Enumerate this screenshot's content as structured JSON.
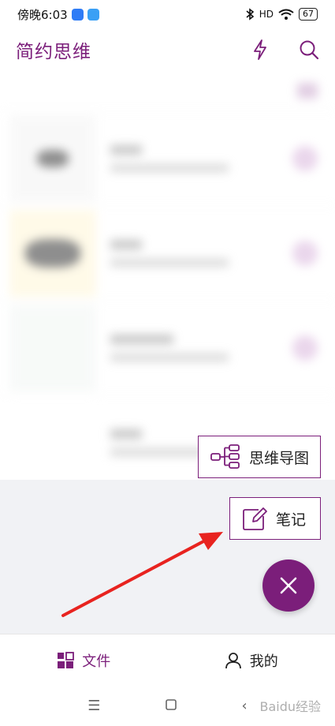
{
  "status_bar": {
    "time": "傍晚6:03",
    "battery": "67",
    "network_label": "HD"
  },
  "header": {
    "title": "简约思维",
    "icons": [
      "lightning-icon",
      "search-icon"
    ]
  },
  "speed_dial": {
    "mind_map_label": "思维导图",
    "note_label": "笔记"
  },
  "bottom_nav": {
    "files_label": "文件",
    "mine_label": "我的"
  },
  "watermark": "Baidu经验",
  "colors": {
    "accent": "#7b1e7a",
    "arrow": "#e8231f",
    "overlay": "#f1f2f5"
  }
}
